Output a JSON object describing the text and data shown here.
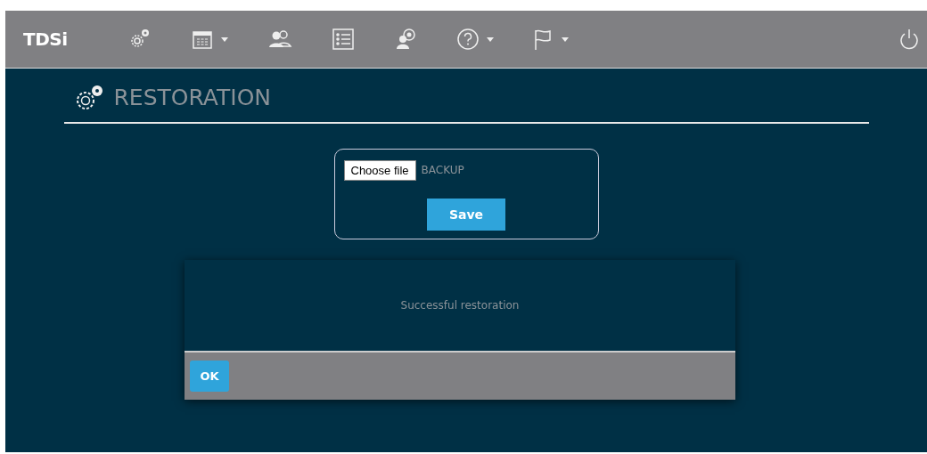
{
  "navbar": {
    "logo": "TDSi",
    "items": [
      {
        "kind": "gears",
        "dropdown": false
      },
      {
        "kind": "calendar",
        "dropdown": true
      },
      {
        "kind": "users",
        "dropdown": false
      },
      {
        "kind": "list",
        "dropdown": false
      },
      {
        "kind": "user-settings",
        "dropdown": false
      },
      {
        "kind": "help",
        "dropdown": true
      },
      {
        "kind": "flag",
        "dropdown": true
      }
    ]
  },
  "page": {
    "title": "RESTORATION"
  },
  "upload": {
    "button": "Choose file",
    "file_name": "BACKUP",
    "save": "Save"
  },
  "dialog": {
    "message": "Successful restoration",
    "ok": "OK"
  }
}
